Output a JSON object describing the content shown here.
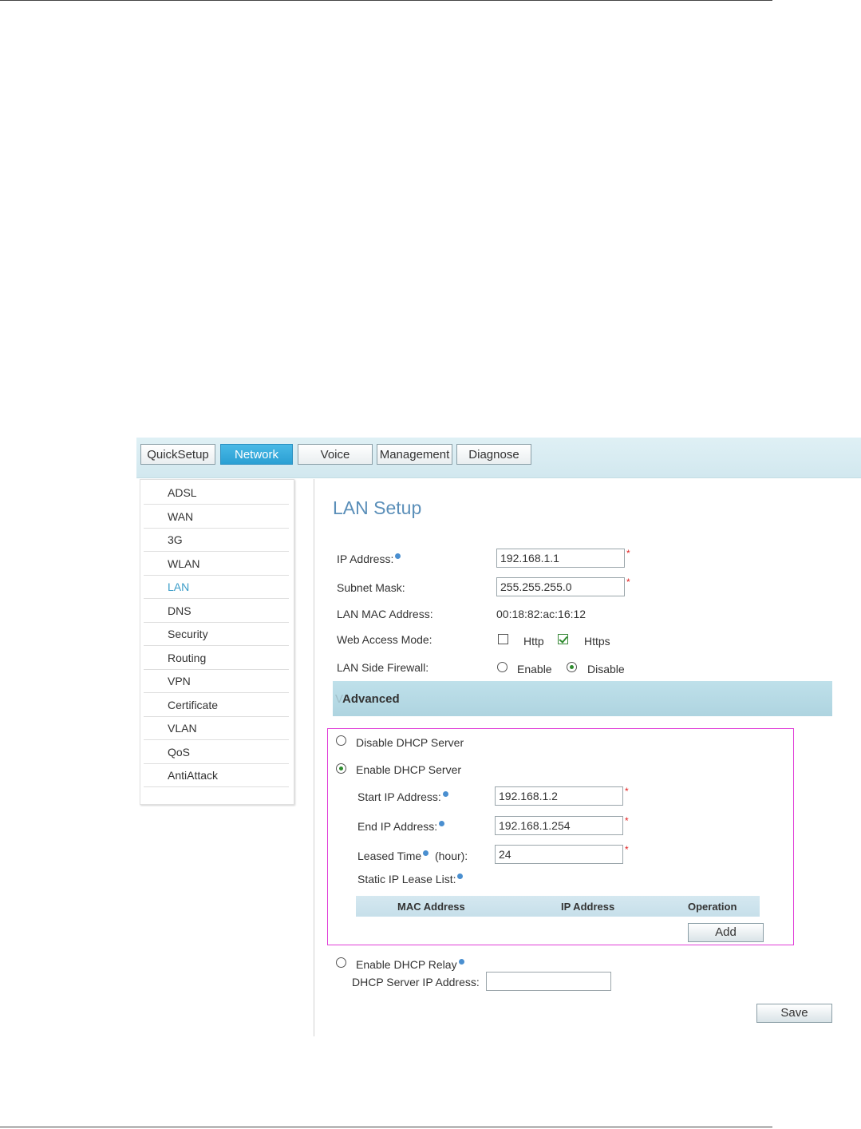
{
  "tabs": [
    {
      "label": "QuickSetup",
      "active": false
    },
    {
      "label": "Network",
      "active": true
    },
    {
      "label": "Voice",
      "active": false
    },
    {
      "label": "Management",
      "active": false
    },
    {
      "label": "Diagnose",
      "active": false
    }
  ],
  "sidebar": {
    "items": [
      {
        "label": "ADSL"
      },
      {
        "label": "WAN"
      },
      {
        "label": "3G"
      },
      {
        "label": "WLAN"
      },
      {
        "label": "LAN",
        "active": true
      },
      {
        "label": "DNS"
      },
      {
        "label": "Security"
      },
      {
        "label": "Routing"
      },
      {
        "label": "VPN"
      },
      {
        "label": "Certificate"
      },
      {
        "label": "VLAN"
      },
      {
        "label": "QoS"
      },
      {
        "label": "AntiAttack"
      }
    ]
  },
  "page": {
    "title": "LAN Setup"
  },
  "lan": {
    "ip_label": "IP Address:",
    "ip_value": "192.168.1.1",
    "mask_label": "Subnet Mask:",
    "mask_value": "255.255.255.0",
    "mac_label": "LAN MAC Address:",
    "mac_value": "00:18:82:ac:16:12",
    "web_label": "Web Access Mode:",
    "http_label": "Http",
    "http_checked": false,
    "https_label": "Https",
    "https_checked": true,
    "firewall_label": "LAN Side Firewall:",
    "enable_label": "Enable",
    "disable_label": "Disable",
    "firewall_value": "Disable",
    "required_mark": "*"
  },
  "advanced": {
    "title": "Advanced",
    "marker": "V"
  },
  "dhcp": {
    "disable_label": "Disable DHCP Server",
    "enable_label": "Enable DHCP Server",
    "selected": "Enable DHCP Server",
    "start_label": "Start IP Address:",
    "start_value": "192.168.1.2",
    "end_label": "End IP Address:",
    "end_value": "192.168.1.254",
    "lease_label": "Leased Time",
    "lease_unit": "(hour):",
    "lease_value": "24",
    "static_label": "Static IP Lease List:",
    "columns": [
      "MAC Address",
      "IP Address",
      "Operation"
    ],
    "add_label": "Add",
    "relay_label": "Enable DHCP Relay",
    "relay_server_label": "DHCP Server IP Address:",
    "relay_server_value": ""
  },
  "actions": {
    "save_label": "Save"
  }
}
